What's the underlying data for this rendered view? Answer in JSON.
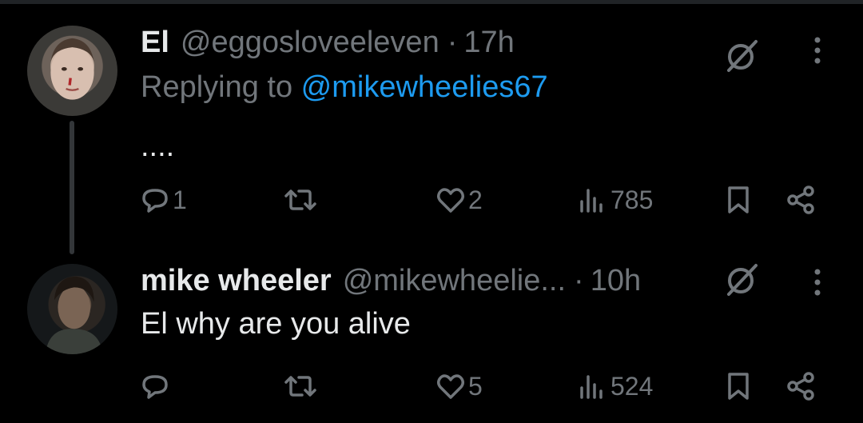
{
  "colors": {
    "background": "#000000",
    "text_primary": "#e7e9ea",
    "text_secondary": "#71767b",
    "link": "#1d9bf0",
    "thread_line": "#333639"
  },
  "tweets": [
    {
      "name": "El",
      "handle": "@eggosloveeleven",
      "dot": "·",
      "time": "17h",
      "replying_prefix": "Replying to ",
      "replying_to": "@mikewheelies67",
      "text": "....",
      "replies": "1",
      "retweets": "",
      "likes": "2",
      "views": "785",
      "icons": [
        "reply-icon",
        "retweet-icon",
        "like-icon",
        "views-icon",
        "bookmark-icon",
        "share-icon",
        "grok-icon",
        "more-icon"
      ]
    },
    {
      "name": "mike wheeler",
      "handle": "@mikewheelie...",
      "dot": "·",
      "time": "10h",
      "text": "El  why are you alive",
      "replies": "",
      "retweets": "",
      "likes": "5",
      "views": "524",
      "icons": [
        "reply-icon",
        "retweet-icon",
        "like-icon",
        "views-icon",
        "bookmark-icon",
        "share-icon",
        "grok-icon",
        "more-icon"
      ]
    }
  ]
}
